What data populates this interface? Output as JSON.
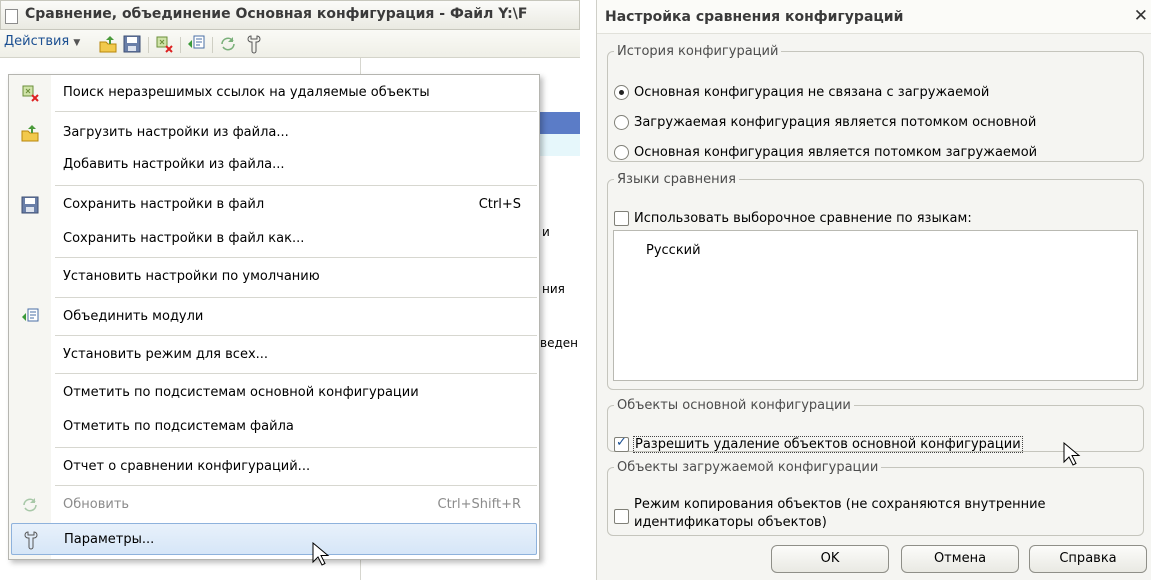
{
  "left_window": {
    "title": "Сравнение, объединение Основная конфигурация - Файл Y:\\F",
    "toolbar": {
      "actions_label": "Действия",
      "icons": [
        "load-settings-icon",
        "save-icon",
        "find-unresolved-icon",
        "merge-modules-icon",
        "refresh-icon",
        "parameters-icon"
      ]
    },
    "background_texts": [
      "и",
      "ния",
      "веден"
    ],
    "menu": {
      "items": [
        {
          "label": "Поиск неразрешимых ссылок на удаляемые объекты",
          "icon": "find-unresolved-icon"
        },
        {
          "label": "Загрузить настройки из файла...",
          "icon": "load-settings-icon"
        },
        {
          "label": "Добавить настройки из файла..."
        },
        {
          "label": "Сохранить настройки в файл",
          "shortcut": "Ctrl+S",
          "icon": "save-icon"
        },
        {
          "label": "Сохранить настройки в файл как..."
        },
        {
          "label": "Установить настройки по умолчанию"
        },
        {
          "label": "Объединить модули",
          "icon": "merge-modules-icon"
        },
        {
          "label": "Установить режим для всех..."
        },
        {
          "label": "Отметить по подсистемам основной конфигурации"
        },
        {
          "label": "Отметить по подсистемам файла"
        },
        {
          "label": "Отчет о сравнении конфигураций..."
        },
        {
          "label": "Обновить",
          "shortcut": "Ctrl+Shift+R",
          "icon": "refresh-icon",
          "disabled": true
        },
        {
          "label": "Параметры...",
          "icon": "parameters-icon",
          "highlighted": true
        }
      ]
    }
  },
  "dialog": {
    "title": "Настройка сравнения конфигураций",
    "close": "✕",
    "history": {
      "legend": "История конфигураций",
      "options": [
        {
          "label": "Основная конфигурация не связана с загружаемой",
          "selected": true
        },
        {
          "label": "Загружаемая конфигурация является потомком основной",
          "selected": false
        },
        {
          "label": "Основная конфигурация является потомком загружаемой",
          "selected": false
        }
      ]
    },
    "languages": {
      "legend": "Языки сравнения",
      "checkbox_label": "Использовать выборочное сравнение по языкам:",
      "checked": false,
      "list": [
        "Русский"
      ]
    },
    "main_objects": {
      "legend": "Объекты основной конфигурации",
      "checkbox_label": "Разрешить удаление объектов основной конфигурации",
      "checked": true
    },
    "loaded_objects": {
      "legend": "Объекты загружаемой конфигурации",
      "checkbox_label_line1": "Режим копирования объектов (не сохраняются внутренние",
      "checkbox_label_line2": "идентификаторы объектов)",
      "checked": false
    },
    "buttons": {
      "ok": "OK",
      "cancel": "Отмена",
      "help": "Справка"
    }
  }
}
